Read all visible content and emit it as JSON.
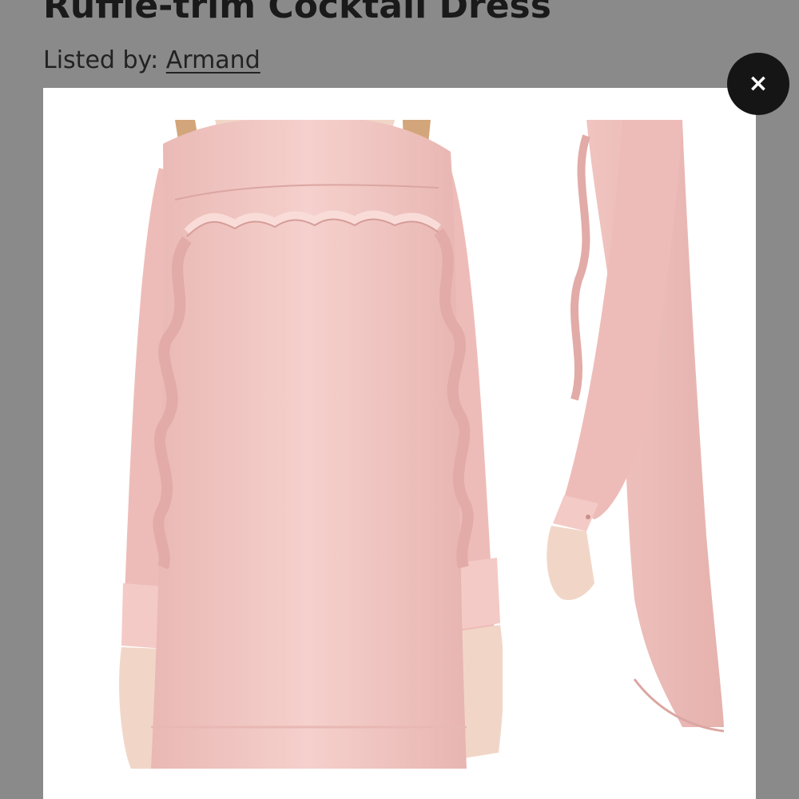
{
  "listing": {
    "title": "Ruffle-trim Cocktail Dress",
    "listed_by_label": "Listed by: ",
    "seller_name": "Armand"
  },
  "modal": {
    "close_icon": "close-icon",
    "close_glyph": "×",
    "image_subject": "pink ruffle-trim long-sleeve cocktail dress, front and side views"
  },
  "colors": {
    "backdrop": "#8a8a8a",
    "modal_background": "#ffffff",
    "close_button": "#151515",
    "dress_pink": "#f2c9c6"
  }
}
